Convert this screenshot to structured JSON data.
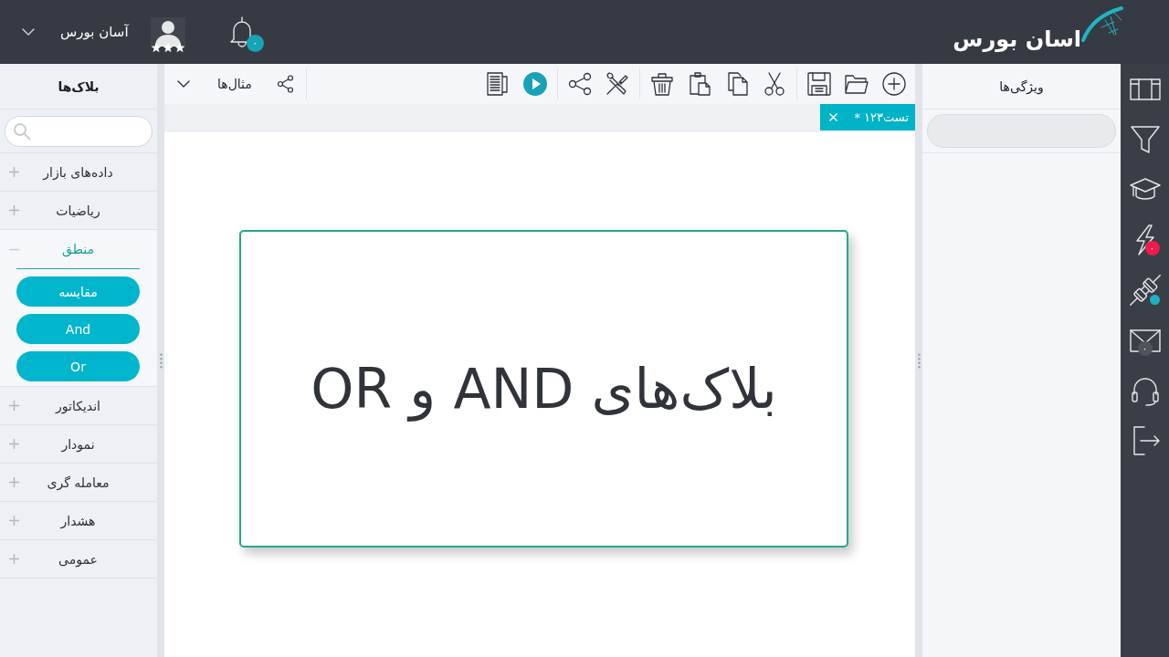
{
  "header": {
    "logo": "اسان بورس",
    "notifications": {
      "badge": "۰"
    },
    "user": {
      "name": "آسان بورس",
      "stars": 3
    }
  },
  "side_rail": {
    "alerts_badge": "۰",
    "connection": {
      "on": true
    },
    "messages_badge": "۰"
  },
  "properties_panel": {
    "title": "ویژگی‌ها"
  },
  "editor": {
    "toolbar": {
      "examples_menu": "مثال‌ها"
    },
    "tabs": [
      {
        "label": "تست۱۲۳ *",
        "selected": true
      }
    ],
    "canvas": {
      "card_title": "بلاک‌های AND و OR"
    }
  },
  "blocks_panel": {
    "title": "بلاک‌ها",
    "categories": [
      {
        "label": "داده‌های بازار",
        "expanded": false
      },
      {
        "label": "ریاضیات",
        "expanded": false
      },
      {
        "label": "منطق",
        "expanded": true,
        "children": [
          {
            "label": "مقایسه"
          },
          {
            "label": "And"
          },
          {
            "label": "Or"
          }
        ]
      },
      {
        "label": "اندیکاتور",
        "expanded": false
      },
      {
        "label": "نمودار",
        "expanded": false
      },
      {
        "label": "معامله گری",
        "expanded": false
      },
      {
        "label": "هشدار",
        "expanded": false
      },
      {
        "label": "عمومی",
        "expanded": false
      }
    ]
  }
}
